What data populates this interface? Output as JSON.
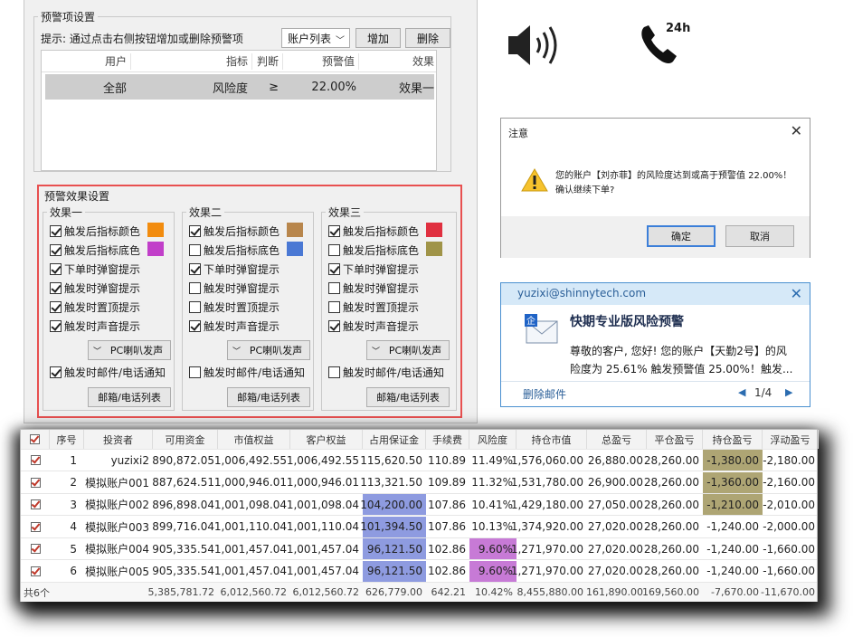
{
  "settings": {
    "group_title": "预警项设置",
    "hint": "提示: 通过点击右侧按钮增加或删除预警项",
    "account_list_label": "账户列表",
    "add_label": "增加",
    "delete_label": "删除",
    "table": {
      "headers": [
        "用户",
        "指标",
        "判断",
        "预警值",
        "效果"
      ],
      "row": {
        "user": "全部",
        "metric": "风险度",
        "op": "≥",
        "value": "22.00%",
        "effect": "效果一"
      }
    },
    "effects": {
      "title": "预警效果设置",
      "groups": [
        {
          "name": "效果一",
          "options": [
            {
              "label": "触发后指标颜色",
              "checked": true,
              "swatch": "#f28c0f"
            },
            {
              "label": "触发后指标底色",
              "checked": true,
              "swatch": "#c13fc9"
            },
            {
              "label": "下单时弹窗提示",
              "checked": true
            },
            {
              "label": "触发时弹窗提示",
              "checked": true
            },
            {
              "label": "触发时置顶提示",
              "checked": true
            },
            {
              "label": "触发时声音提示",
              "checked": true
            }
          ],
          "sound_label": "PC喇叭发声",
          "notify_label": "触发时邮件/电话通知",
          "notify_checked": true,
          "list_label": "邮箱/电话列表"
        },
        {
          "name": "效果二",
          "options": [
            {
              "label": "触发后指标颜色",
              "checked": true,
              "swatch": "#b8864c"
            },
            {
              "label": "触发后指标底色",
              "checked": false,
              "swatch": "#4a78d4"
            },
            {
              "label": "下单时弹窗提示",
              "checked": true
            },
            {
              "label": "触发时弹窗提示",
              "checked": false
            },
            {
              "label": "触发时置顶提示",
              "checked": false
            },
            {
              "label": "触发时声音提示",
              "checked": true
            }
          ],
          "sound_label": "PC喇叭发声",
          "notify_label": "触发时邮件/电话通知",
          "notify_checked": false,
          "list_label": "邮箱/电话列表"
        },
        {
          "name": "效果三",
          "options": [
            {
              "label": "触发后指标颜色",
              "checked": true,
              "swatch": "#e03040"
            },
            {
              "label": "触发后指标底色",
              "checked": false,
              "swatch": "#a09448"
            },
            {
              "label": "下单时弹窗提示",
              "checked": true
            },
            {
              "label": "触发时弹窗提示",
              "checked": false
            },
            {
              "label": "触发时置顶提示",
              "checked": false
            },
            {
              "label": "触发时声音提示",
              "checked": true
            }
          ],
          "sound_label": "PC喇叭发声",
          "notify_label": "触发时邮件/电话通知",
          "notify_checked": false,
          "list_label": "邮箱/电话列表"
        }
      ]
    }
  },
  "icons": {
    "speaker": "speaker-icon",
    "phone": "phone-24h-icon",
    "phone_text": "24h"
  },
  "dialog": {
    "title": "注意",
    "message_line1": "您的账户【刘亦菲】的风险度达到或高于预警值 22.00%！",
    "message_line2": "确认继续下单?",
    "ok_label": "确定",
    "cancel_label": "取消"
  },
  "notification": {
    "sender": "yuzixi@shinnytech.com",
    "title": "快期专业版风险预警",
    "body_line1": "尊敬的客户, 您好!  您的账户【天勤2号】的风",
    "body_line2": "险度为 25.61% 触发预警值 25.00%！触发...",
    "delete_label": "删除邮件",
    "pager": "1/4"
  },
  "grid": {
    "headers": [
      "",
      "序号",
      "投资者",
      "可用资金",
      "市值权益",
      "客户权益",
      "占用保证金",
      "手续费",
      "风险度",
      "持仓市值",
      "总盈亏",
      "平仓盈亏",
      "持仓盈亏",
      "浮动盈亏"
    ],
    "rows": [
      [
        "1",
        "yuzixi2",
        "890,872.05",
        "1,006,492.55",
        "1,006,492.55",
        "115,620.50",
        "110.89",
        "11.49%",
        "1,576,060.00",
        "26,880.00",
        "28,260.00",
        "-1,380.00",
        "-2,180.00"
      ],
      [
        "2",
        "模拟账户001",
        "887,624.51",
        "1,000,946.01",
        "1,000,946.01",
        "113,321.50",
        "109.89",
        "11.32%",
        "1,531,780.00",
        "26,900.00",
        "28,260.00",
        "-1,360.00",
        "-2,160.00"
      ],
      [
        "3",
        "模拟账户002",
        "896,898.04",
        "1,001,098.04",
        "1,001,098.04",
        "104,200.00",
        "107.86",
        "10.41%",
        "1,429,180.00",
        "27,050.00",
        "28,260.00",
        "-1,210.00",
        "-2,010.00"
      ],
      [
        "4",
        "模拟账户003",
        "899,716.04",
        "1,001,110.04",
        "1,001,110.04",
        "101,394.50",
        "107.86",
        "10.13%",
        "1,374,920.00",
        "27,020.00",
        "28,260.00",
        "-1,240.00",
        "-2,000.00"
      ],
      [
        "5",
        "模拟账户004",
        "905,335.54",
        "1,001,457.04",
        "1,001,457.04",
        "96,121.50",
        "102.86",
        "9.60%",
        "1,271,970.00",
        "27,020.00",
        "28,260.00",
        "-1,240.00",
        "-1,660.00"
      ],
      [
        "6",
        "模拟账户005",
        "905,335.54",
        "1,001,457.04",
        "1,001,457.04",
        "96,121.50",
        "102.86",
        "9.60%",
        "1,271,970.00",
        "27,020.00",
        "28,260.00",
        "-1,240.00",
        "-1,660.00"
      ]
    ],
    "footer": [
      "共6个",
      "",
      "5,385,781.72",
      "6,012,560.72",
      "6,012,560.72",
      "626,779.00",
      "642.21",
      "10.42%",
      "8,455,880.00",
      "161,890.00",
      "169,560.00",
      "-7,670.00",
      "-11,670.00"
    ],
    "highlight_colors": {
      "margin": "#8e9be0",
      "risk": "#c77ad6",
      "position_pnl": "#aea574"
    }
  }
}
